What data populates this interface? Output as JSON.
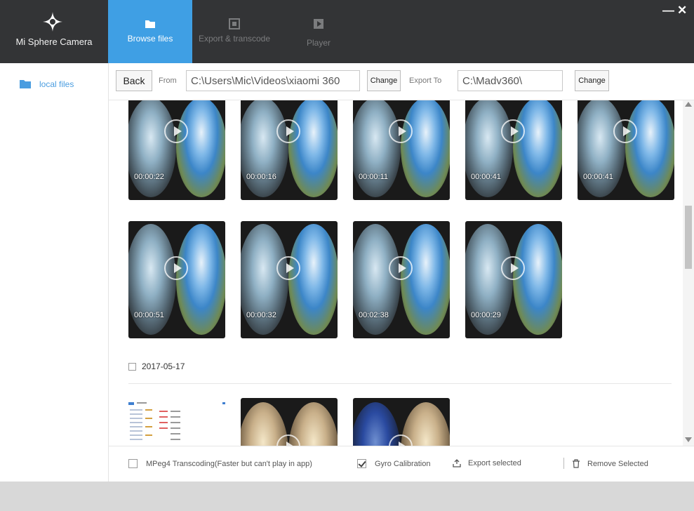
{
  "header": {
    "app_title": "Mi Sphere Camera",
    "tabs": [
      {
        "label": "Browse files",
        "active": true,
        "icon": "folder-icon"
      },
      {
        "label": "Export & transcode",
        "active": false,
        "icon": "export-icon"
      },
      {
        "label": "Player",
        "active": false,
        "icon": "play-icon"
      }
    ],
    "window_controls": {
      "minimize": "—",
      "close": "✕"
    }
  },
  "sidebar": {
    "items": [
      {
        "label": "local files",
        "icon": "folder-icon"
      }
    ]
  },
  "toolbar": {
    "back_label": "Back",
    "from_label": "From",
    "from_path": "C:\\Users\\Mic\\Videos\\xiaomi 360",
    "change_label": "Change",
    "export_label": "Export To",
    "export_path": "C:\\Madv360\\",
    "change2_label": "Change"
  },
  "videos": [
    {
      "duration": "00:00:22"
    },
    {
      "duration": "00:00:16"
    },
    {
      "duration": "00:00:11"
    },
    {
      "duration": "00:00:41"
    },
    {
      "duration": "00:00:41"
    },
    {
      "duration": "00:00:51"
    },
    {
      "duration": "00:00:32"
    },
    {
      "duration": "00:02:38"
    },
    {
      "duration": "00:00:29"
    }
  ],
  "group": {
    "date": "2017-05-17"
  },
  "actions": {
    "mpeg4_label": "MPeg4 Transcoding(Faster but can't play in app)",
    "mpeg4_checked": false,
    "gyro_label": "Gyro Calibration",
    "gyro_checked": true,
    "export_label": "Export selected",
    "remove_label": "Remove Selected"
  },
  "colors": {
    "header_bg": "#333436",
    "accent": "#3f9fe4",
    "link": "#4a9de0"
  }
}
